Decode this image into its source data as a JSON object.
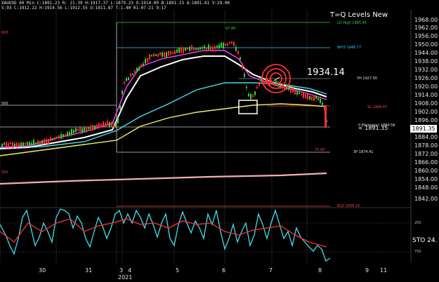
{
  "header": {
    "line1": "XAUUSD 60 Min  C:1891.23 R:  21.39 H:1917.37 L:1879.23 O:1914.09 B:1891.23 A:1891.61 V:29.0K",
    "line2": "S:93 C:1912.22 H:1914.56 L:1912.55 O:1911.87 T:1.40 01-07-21 9:17"
  },
  "chart_title": "T=Q Levels New",
  "annotation_price": "1934.14",
  "current_price_callout": "< 1891.35",
  "current_price_tag": "1891.35",
  "levels": [
    {
      "label": "LD High 1965.45",
      "color": "#3cd23c"
    },
    {
      "label": "WH3 1948.77",
      "color": "#35c8ff"
    },
    {
      "label": "97.89",
      "color": "#3cd23c"
    },
    {
      "label": "YH 1927.50",
      "color": "#e6e6e6"
    },
    {
      "label": "SL 1906.67",
      "color": "#ff4040"
    },
    {
      "label": "0 Fib(major) 1890.58",
      "color": "#e6e6e6"
    },
    {
      "label": "75.93",
      "color": "#ff4040"
    },
    {
      "label": "3P 1874.41",
      "color": "#e6e6e6"
    },
    {
      "label": "BLD 1838.15",
      "color": "#ff4040"
    }
  ],
  "left_labels": [
    {
      "label": "600",
      "color": "#ff4040"
    },
    {
      "label": "500",
      "color": "#e6e6e6"
    },
    {
      "label": "300",
      "color": "#ff4040"
    }
  ],
  "y_axis": [
    "1968.00",
    "1962.00",
    "1956.00",
    "1950.00",
    "1944.00",
    "1938.00",
    "1932.00",
    "1926.00",
    "1920.00",
    "1914.00",
    "1908.00",
    "1902.00",
    "1896.00",
    "1884.00",
    "1878.00",
    "1872.00",
    "1866.00",
    "1860.00",
    "1854.00",
    "1848.00",
    "1842.00"
  ],
  "x_axis": [
    "30",
    "31",
    "3",
    "4",
    "5",
    "6",
    "7",
    "8",
    "9",
    "11"
  ],
  "x_sublabel": "2021",
  "oscillator": {
    "name": "STO  24.",
    "levels": [
      "250",
      "750"
    ]
  },
  "colors": {
    "background": "#000000",
    "bull_candle": "#3cd23c",
    "bear_candle": "#ff3030",
    "ema_white": "#ffffff",
    "ema_cyan": "#40e0f0",
    "ema_yellow": "#f2ef6a",
    "ema_magenta": "#ff40ff",
    "ema_pink": "#f0a0b0",
    "target_red": "#ff3030"
  }
}
